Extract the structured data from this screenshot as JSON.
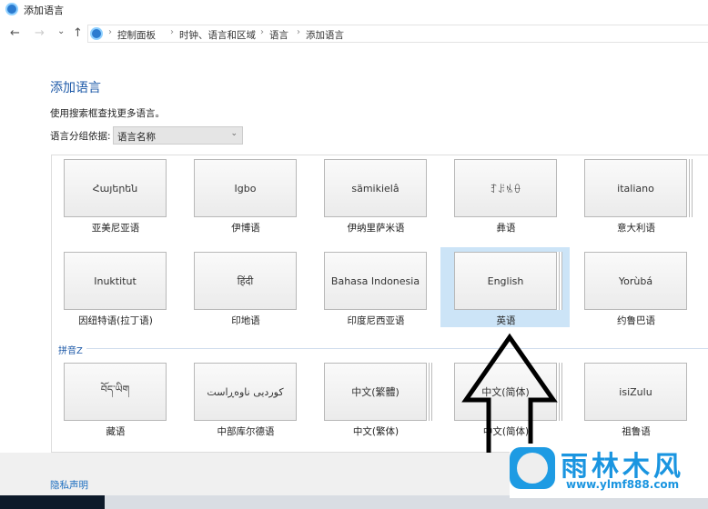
{
  "window": {
    "title": "添加语言"
  },
  "nav": {
    "back": "←",
    "forward": "→",
    "recent": "⌄",
    "up": "↑"
  },
  "breadcrumb": [
    "控制面板",
    "时钟、语言和区域",
    "语言",
    "添加语言"
  ],
  "main": {
    "heading": "添加语言",
    "hint": "使用搜索框查找更多语言。",
    "group_label": "语言分组依据:",
    "group_value": "语言名称"
  },
  "rows": [
    [
      {
        "native": "Հայերեն",
        "name": "亚美尼亚语"
      },
      {
        "native": "Igbo",
        "name": "伊博语"
      },
      {
        "native": "sämikielâ",
        "name": "伊纳里萨米语"
      },
      {
        "native": "ꆈꌠꁱꂷ",
        "name": "彝语"
      },
      {
        "native": "italiano",
        "name": "意大利语",
        "multi": true
      }
    ],
    [
      {
        "native": "Inuktitut",
        "name": "因纽特语(拉丁语)"
      },
      {
        "native": "हिंदी",
        "name": "印地语"
      },
      {
        "native": "Bahasa Indonesia",
        "name": "印度尼西亚语"
      },
      {
        "native": "English",
        "name": "英语",
        "multi": true,
        "selected": true
      },
      {
        "native": "Yorùbá",
        "name": "约鲁巴语"
      }
    ],
    [
      {
        "native": "བོད་ཡིག",
        "name": "藏语"
      },
      {
        "native": "کوردیی ناوەڕاست",
        "name": "中部库尔德语"
      },
      {
        "native": "中文(繁體)",
        "name": "中文(繁体)",
        "multi": true
      },
      {
        "native": "中文(简体)",
        "name": "中文(简体)",
        "multi": true
      },
      {
        "native": "isiZulu",
        "name": "祖鲁语"
      }
    ]
  ],
  "group_header": "拼音Z",
  "footer": {
    "privacy": "隐私声明"
  },
  "watermark": {
    "name": "雨林木风",
    "url": "www.ylmf888.com"
  },
  "colors": {
    "accent": "#1e5aa8",
    "selected": "#cce4f7"
  }
}
